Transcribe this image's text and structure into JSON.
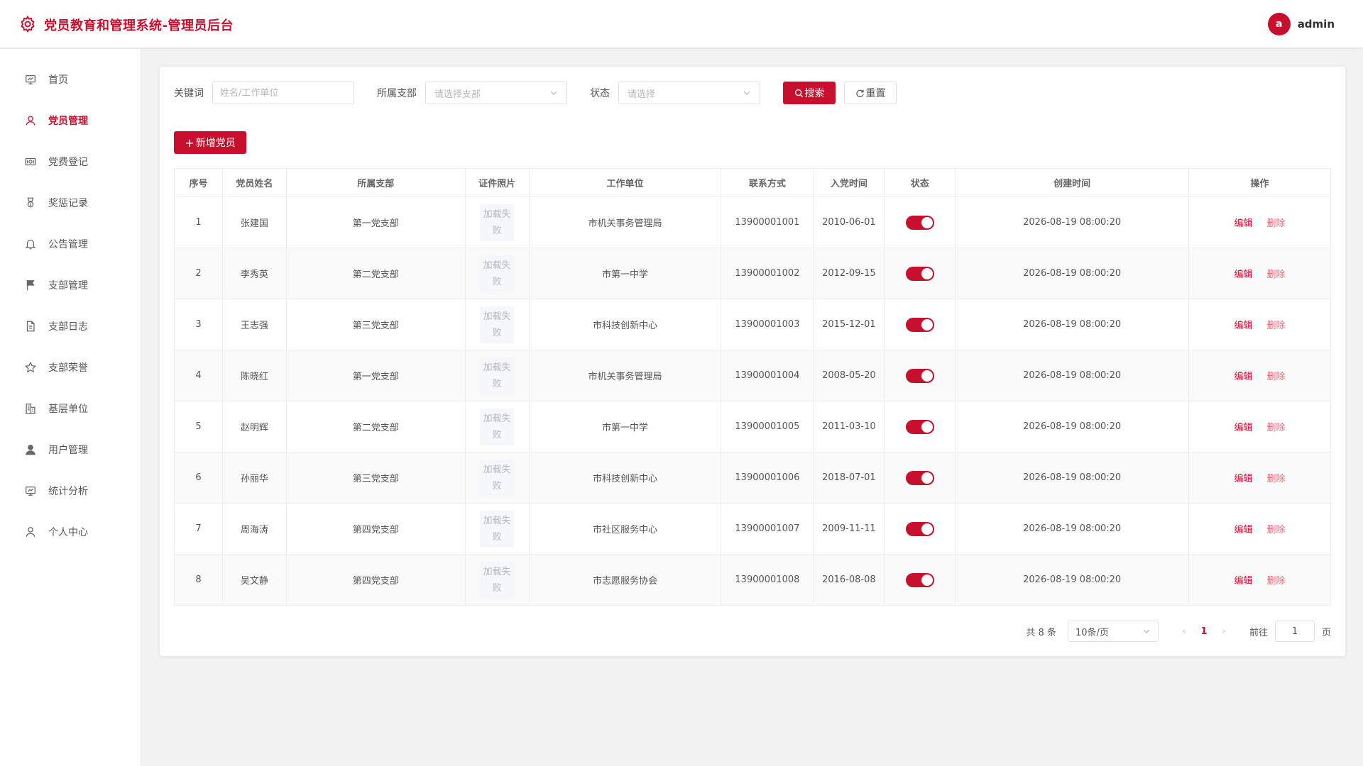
{
  "header": {
    "title": "党员教育和管理系统-管理员后台",
    "avatar_letter": "a",
    "username": "admin",
    "accent": "#c8102e"
  },
  "sidebar": {
    "items": [
      {
        "label": "首页",
        "icon": "dashboard-icon",
        "active": false
      },
      {
        "label": "党员管理",
        "icon": "user-outline-icon",
        "active": true
      },
      {
        "label": "党费登记",
        "icon": "money-icon",
        "active": false
      },
      {
        "label": "奖惩记录",
        "icon": "medal-icon",
        "active": false
      },
      {
        "label": "公告管理",
        "icon": "bell-icon",
        "active": false
      },
      {
        "label": "支部管理",
        "icon": "flag-icon",
        "active": false
      },
      {
        "label": "支部日志",
        "icon": "document-icon",
        "active": false
      },
      {
        "label": "支部荣誉",
        "icon": "star-icon",
        "active": false
      },
      {
        "label": "基层单位",
        "icon": "office-building-icon",
        "active": false
      },
      {
        "label": "用户管理",
        "icon": "user-filled-icon",
        "active": false
      },
      {
        "label": "统计分析",
        "icon": "chart-icon",
        "active": false
      },
      {
        "label": "个人中心",
        "icon": "person-icon",
        "active": false
      }
    ]
  },
  "filters": {
    "keyword_label": "关键词",
    "keyword_placeholder": "姓名/工作单位",
    "keyword_value": "",
    "branch_label": "所属支部",
    "branch_placeholder": "请选择支部",
    "status_label": "状态",
    "status_placeholder": "请选择",
    "search_label": "搜索",
    "reset_label": "重置"
  },
  "actions": {
    "add_label": "新增党员"
  },
  "table": {
    "columns": [
      "序号",
      "党员姓名",
      "所属支部",
      "证件照片",
      "工作单位",
      "联系方式",
      "入党时间",
      "状态",
      "创建时间",
      "操作"
    ],
    "photo_fail_text": "加载失败",
    "edit_label": "编辑",
    "delete_label": "删除",
    "rows": [
      {
        "no": "1",
        "name": "张建国",
        "branch": "第一党支部",
        "unit": "市机关事务管理局",
        "phone": "13900001001",
        "join": "2010-06-01",
        "enabled": true,
        "created": "2026-08-19 08:00:20"
      },
      {
        "no": "2",
        "name": "李秀英",
        "branch": "第二党支部",
        "unit": "市第一中学",
        "phone": "13900001002",
        "join": "2012-09-15",
        "enabled": true,
        "created": "2026-08-19 08:00:20"
      },
      {
        "no": "3",
        "name": "王志强",
        "branch": "第三党支部",
        "unit": "市科技创新中心",
        "phone": "13900001003",
        "join": "2015-12-01",
        "enabled": true,
        "created": "2026-08-19 08:00:20"
      },
      {
        "no": "4",
        "name": "陈晓红",
        "branch": "第一党支部",
        "unit": "市机关事务管理局",
        "phone": "13900001004",
        "join": "2008-05-20",
        "enabled": true,
        "created": "2026-08-19 08:00:20"
      },
      {
        "no": "5",
        "name": "赵明辉",
        "branch": "第二党支部",
        "unit": "市第一中学",
        "phone": "13900001005",
        "join": "2011-03-10",
        "enabled": true,
        "created": "2026-08-19 08:00:20"
      },
      {
        "no": "6",
        "name": "孙丽华",
        "branch": "第三党支部",
        "unit": "市科技创新中心",
        "phone": "13900001006",
        "join": "2018-07-01",
        "enabled": true,
        "created": "2026-08-19 08:00:20"
      },
      {
        "no": "7",
        "name": "周海涛",
        "branch": "第四党支部",
        "unit": "市社区服务中心",
        "phone": "13900001007",
        "join": "2009-11-11",
        "enabled": true,
        "created": "2026-08-19 08:00:20"
      },
      {
        "no": "8",
        "name": "吴文静",
        "branch": "第四党支部",
        "unit": "市志愿服务协会",
        "phone": "13900001008",
        "join": "2016-08-08",
        "enabled": true,
        "created": "2026-08-19 08:00:20"
      }
    ]
  },
  "pagination": {
    "total_text": "共 8 条",
    "page_size": "10条/页",
    "current_page": "1",
    "goto_label": "前往",
    "goto_value": "1",
    "page_suffix": "页"
  }
}
